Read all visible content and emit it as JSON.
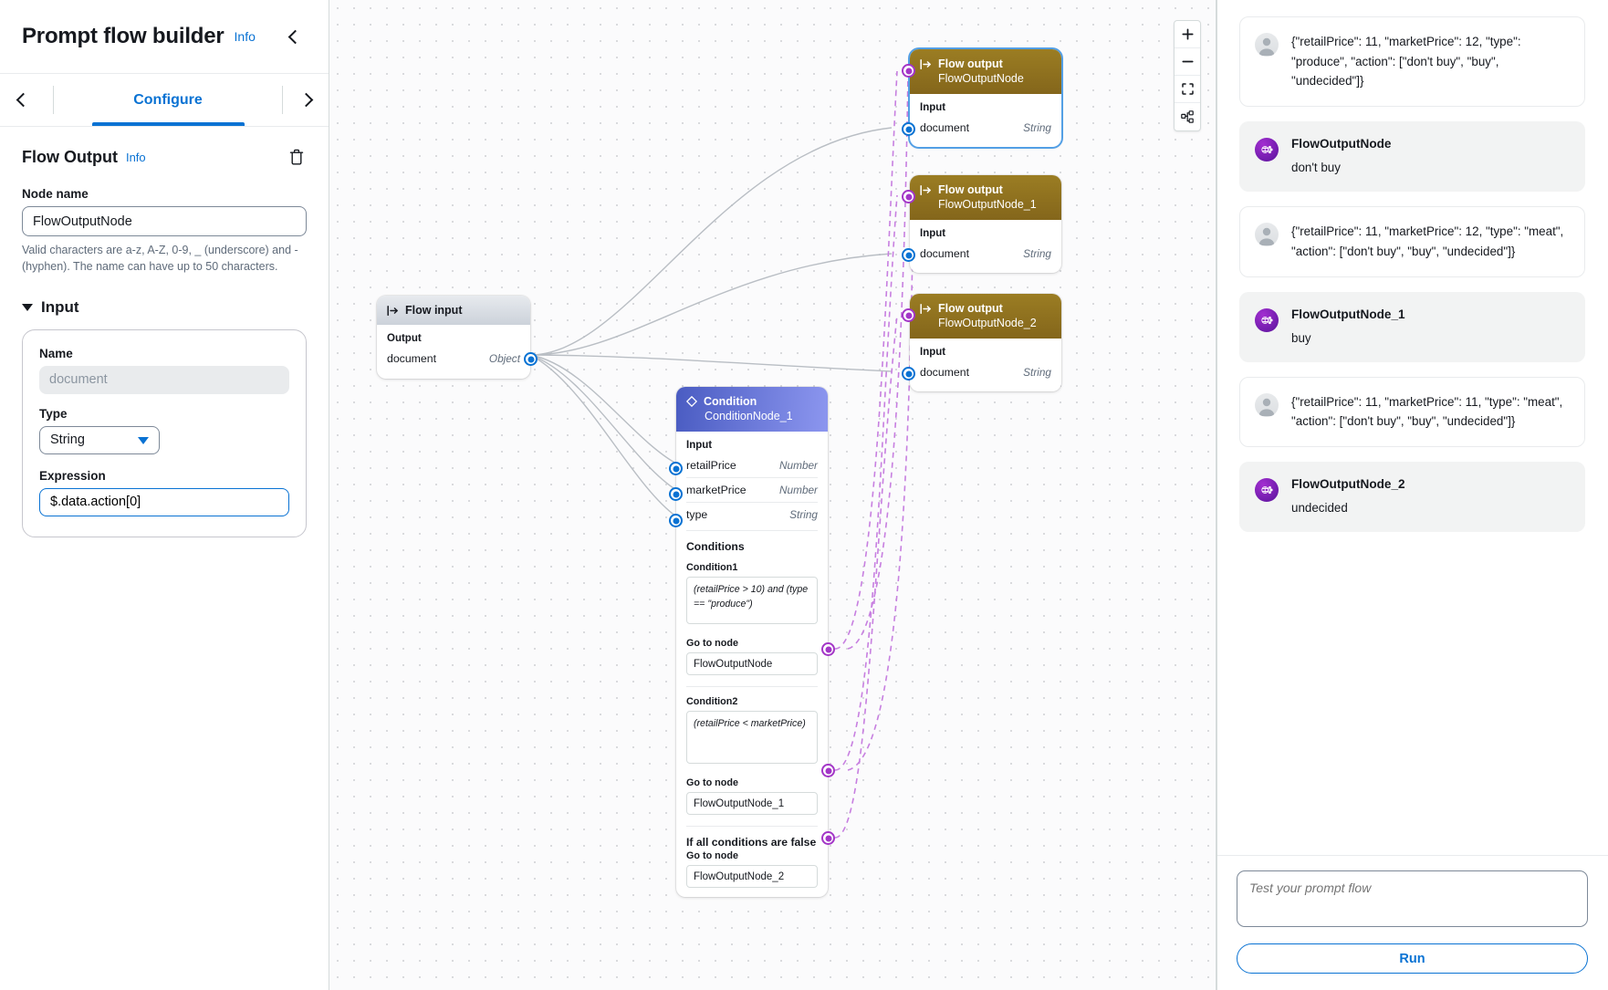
{
  "left_panel": {
    "title": "Prompt flow builder",
    "info_label": "Info",
    "collapse_icon": "chevron-left-icon",
    "tabs": {
      "prev_icon": "chevron-left-icon",
      "next_icon": "chevron-right-icon",
      "partial_tab_label": "",
      "active_tab": "Configure"
    },
    "section": {
      "title": "Flow Output",
      "info_label": "Info",
      "delete_icon": "trash-icon"
    },
    "node_name": {
      "label": "Node name",
      "value": "FlowOutputNode",
      "hint": "Valid characters are a-z, A-Z, 0-9, _ (underscore) and -(hyphen). The name can have up to 50 characters."
    },
    "input_group": {
      "title": "Input",
      "name_label": "Name",
      "name_value": "document",
      "type_label": "Type",
      "type_value": "String",
      "type_caret_icon": "chevron-down-icon",
      "expression_label": "Expression",
      "expression_value": "$.data.action[0]"
    }
  },
  "canvas": {
    "controls": [
      {
        "name": "zoom-in",
        "glyph": "+"
      },
      {
        "name": "zoom-out",
        "glyph": "−"
      },
      {
        "name": "fit-to-screen",
        "glyph": "fit-icon"
      },
      {
        "name": "auto-layout",
        "glyph": "layout-icon"
      }
    ],
    "flow_input": {
      "icon": "flow-input-icon",
      "type_label": "Flow input",
      "section_label": "Output",
      "rows": [
        {
          "name": "document",
          "type": "Object"
        }
      ]
    },
    "flow_outputs": [
      {
        "icon": "flow-output-icon",
        "type_label": "Flow output",
        "name": "FlowOutputNode",
        "section_label": "Input",
        "rows": [
          {
            "name": "document",
            "type": "String"
          }
        ],
        "selected": true
      },
      {
        "icon": "flow-output-icon",
        "type_label": "Flow output",
        "name": "FlowOutputNode_1",
        "section_label": "Input",
        "rows": [
          {
            "name": "document",
            "type": "String"
          }
        ],
        "selected": false
      },
      {
        "icon": "flow-output-icon",
        "type_label": "Flow output",
        "name": "FlowOutputNode_2",
        "section_label": "Input",
        "rows": [
          {
            "name": "document",
            "type": "String"
          }
        ],
        "selected": false
      }
    ],
    "condition_node": {
      "icon": "condition-diamond-icon",
      "type_label": "Condition",
      "name": "ConditionNode_1",
      "input_label": "Input",
      "inputs": [
        {
          "name": "retailPrice",
          "type": "Number"
        },
        {
          "name": "marketPrice",
          "type": "Number"
        },
        {
          "name": "type",
          "type": "String"
        }
      ],
      "conditions_label": "Conditions",
      "conditions": [
        {
          "label": "Condition1",
          "expression": "(retailPrice > 10) and (type == \"produce\")",
          "goto_label": "Go to node",
          "goto_value": "FlowOutputNode"
        },
        {
          "label": "Condition2",
          "expression": "(retailPrice < marketPrice)",
          "goto_label": "Go to node",
          "goto_value": "FlowOutputNode_1"
        }
      ],
      "fallback_label": "If all conditions are false",
      "fallback_goto_label": "Go to node",
      "fallback_goto_value": "FlowOutputNode_2"
    }
  },
  "right_panel": {
    "messages": [
      {
        "role": "user",
        "avatar_icon": "user-avatar-icon",
        "text": "{\"retailPrice\": 11, \"marketPrice\": 12, \"type\": \"produce\", \"action\": [\"don't buy\", \"buy\", \"undecided\"]}"
      },
      {
        "role": "bot",
        "avatar_icon": "bedrock-agent-icon",
        "name": "FlowOutputNode",
        "text": "don't buy"
      },
      {
        "role": "user",
        "avatar_icon": "user-avatar-icon",
        "text": "{\"retailPrice\": 11, \"marketPrice\": 12, \"type\": \"meat\", \"action\": [\"don't buy\", \"buy\", \"undecided\"]}"
      },
      {
        "role": "bot",
        "avatar_icon": "bedrock-agent-icon",
        "name": "FlowOutputNode_1",
        "text": "buy"
      },
      {
        "role": "user",
        "avatar_icon": "user-avatar-icon",
        "text": "{\"retailPrice\": 11, \"marketPrice\": 11, \"type\": \"meat\", \"action\": [\"don't buy\", \"buy\", \"undecided\"]}"
      },
      {
        "role": "bot",
        "avatar_icon": "bedrock-agent-icon",
        "name": "FlowOutputNode_2",
        "text": "undecided"
      }
    ],
    "composer": {
      "placeholder": "Test your prompt flow",
      "value": "",
      "run_label": "Run"
    }
  },
  "colors": {
    "accent_blue": "#0972d3",
    "flow_output_gold": "#8b6c1d",
    "condition_indigo": "#5b6ed0",
    "port_purple": "#a336c7",
    "canvas_bg": "#fbfbfc"
  }
}
